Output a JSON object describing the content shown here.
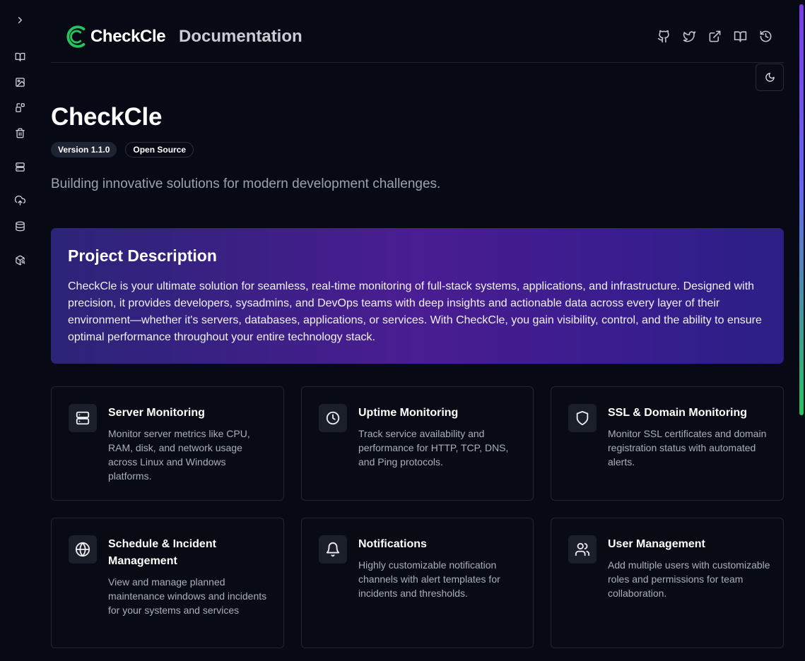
{
  "sidebar": {
    "icons": [
      {
        "name": "chevron-right-icon"
      },
      {
        "name": "book-icon"
      },
      {
        "name": "image-icon"
      },
      {
        "name": "shapes-icon"
      },
      {
        "name": "trash-icon"
      },
      {
        "name": "server-icon"
      },
      {
        "name": "cloud-upload-icon"
      },
      {
        "name": "database-icon"
      },
      {
        "name": "package-search-icon"
      }
    ]
  },
  "header": {
    "brand": "CheckCle",
    "title": "Documentation",
    "icons": [
      "github-icon",
      "twitter-icon",
      "external-link-icon",
      "book-open-icon",
      "history-icon"
    ]
  },
  "theme_toggle_icon": "moon-icon",
  "page": {
    "title": "CheckCle",
    "badges": {
      "version": "Version 1.1.0",
      "license": "Open Source"
    },
    "subtitle": "Building innovative solutions for modern development challenges."
  },
  "hero": {
    "title": "Project Description",
    "text": "CheckCle is your ultimate solution for seamless, real-time monitoring of full-stack systems, applications, and infrastructure. Designed with precision, it provides developers, sysadmins, and DevOps teams with deep insights and actionable data across every layer of their environment—whether it's servers, databases, applications, or services. With CheckCle, you gain visibility, control, and the ability to ensure optimal performance throughout your entire technology stack."
  },
  "features": [
    {
      "title": "Server Monitoring",
      "desc": "Monitor server metrics like CPU, RAM, disk, and network usage across Linux and Windows platforms.",
      "icon": "server-icon"
    },
    {
      "title": "Uptime Monitoring",
      "desc": "Track service availability and performance for HTTP, TCP, DNS, and Ping protocols.",
      "icon": "clock-icon"
    },
    {
      "title": "SSL & Domain Monitoring",
      "desc": "Monitor SSL certificates and domain registration status with automated alerts.",
      "icon": "shield-icon"
    },
    {
      "title": "Schedule & Incident Management",
      "desc": "View and manage planned maintenance windows and incidents for your systems and services",
      "icon": "globe-icon"
    },
    {
      "title": "Notifications",
      "desc": "Highly customizable notification channels with alert templates for incidents and thresholds.",
      "icon": "bell-icon"
    },
    {
      "title": "User Management",
      "desc": "Add multiple users with customizable roles and permissions for team collaboration.",
      "icon": "users-icon"
    }
  ],
  "colors": {
    "background": "#070a14",
    "brand_green": "#22c55e",
    "hero_gradient_start": "#2b2478",
    "hero_gradient_mid": "#4a1d92"
  }
}
